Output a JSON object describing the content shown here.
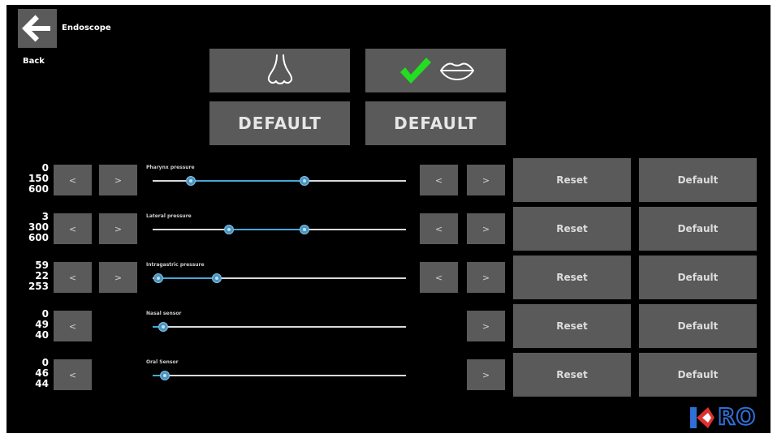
{
  "header": {
    "title": "Endoscope",
    "back_label": "Back"
  },
  "modes": {
    "nose_icon": "nose-icon",
    "mouth_icon": "lips-icon",
    "selected": "oral",
    "check_color": "#22dd22",
    "nasal_default_label": "DEFAULT",
    "oral_default_label": "DEFAULT"
  },
  "rows": [
    {
      "label": "Pharynx pressure",
      "values": [
        "0",
        "150",
        "600"
      ],
      "knobs": [
        0.15,
        0.6
      ],
      "reset_label": "Reset",
      "default_label": "Default",
      "dec_label": "<",
      "inc_label": ">"
    },
    {
      "label": "Lateral pressure",
      "values": [
        "3",
        "300",
        "600"
      ],
      "knobs": [
        0.3,
        0.6
      ],
      "reset_label": "Reset",
      "default_label": "Default",
      "dec_label": "<",
      "inc_label": ">"
    },
    {
      "label": "Intragastric pressure",
      "values": [
        "59",
        "22",
        "253"
      ],
      "knobs": [
        0.02,
        0.25
      ],
      "reset_label": "Reset",
      "default_label": "Default",
      "dec_label": "<",
      "inc_label": ">"
    },
    {
      "label": "Nasal sensor",
      "values": [
        "0",
        "49",
        "40"
      ],
      "knobs": [
        0.04
      ],
      "reset_label": "Reset",
      "default_label": "Default",
      "dec_label": "<",
      "inc_label": ">"
    },
    {
      "label": "Oral Sensor",
      "values": [
        "0",
        "46",
        "44"
      ],
      "knobs": [
        0.05
      ],
      "reset_label": "Reset",
      "default_label": "Default",
      "dec_label": "<",
      "inc_label": ">"
    }
  ],
  "logo": {
    "text": "RO",
    "brand_red": "#e03030",
    "brand_blue": "#2f6fd8"
  }
}
